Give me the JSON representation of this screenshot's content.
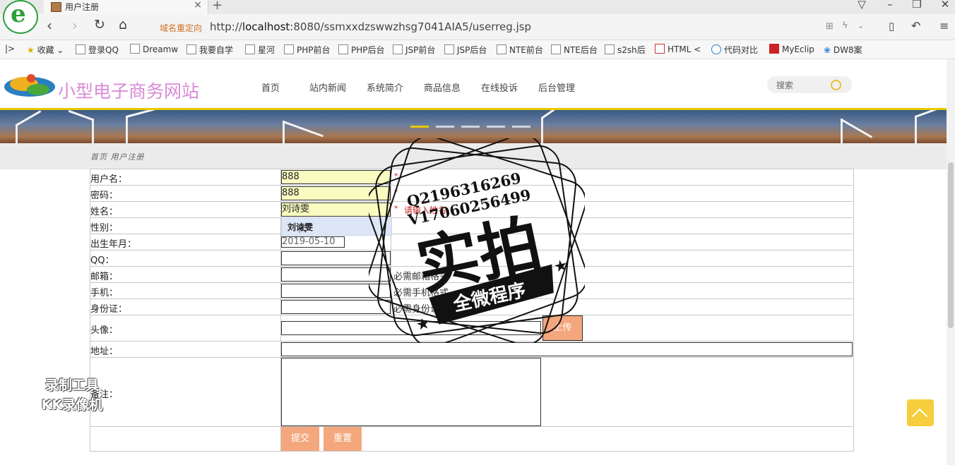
{
  "browser": {
    "tab_title": "用户注册",
    "tab_close": "×",
    "new_tab": "+",
    "redirect_label": "域名重定向",
    "url_prefix": "http://",
    "url_host": "localhost",
    "url_rest": ":8080/ssmxxdzswwzhsg7041AIA5/userreg.jsp",
    "bookmarks": [
      "收藏",
      "登录QQ",
      "Dreamw",
      "我要自学",
      "星河",
      "PHP前台",
      "PHP后台",
      "JSP前台",
      "JSP后台",
      "NTE前台",
      "NTE后台",
      "s2sh后",
      "HTML <",
      "代码对比",
      "MyEclip",
      "DW8案"
    ]
  },
  "site": {
    "title": "小型电子商务网站",
    "nav": [
      "首页",
      "站内新闻",
      "系统简介",
      "商品信息",
      "在线投诉",
      "后台管理"
    ],
    "search_placeholder": "搜索",
    "breadcrumb": "首页 用户注册"
  },
  "form": {
    "username_label": "用户名：",
    "username_value": "888",
    "password_label": "密码：",
    "password_value": "888",
    "name_label": "姓名：",
    "name_value": "刘诗雯",
    "name_hint": "请输入姓名",
    "autocomplete_option": "刘诗雯",
    "gender_label": "性别：",
    "birth_label": "出生年月：",
    "birth_value": "2019-05-10",
    "qq_label": "QQ：",
    "email_label": "邮箱：",
    "email_hint": "必需邮箱格式",
    "phone_label": "手机：",
    "phone_hint": "必需手机格式",
    "idcard_label": "身份证：",
    "idcard_hint": "必需身份证",
    "avatar_label": "头像：",
    "upload_label": "上传",
    "address_label": "地址：",
    "remark_label": "备注：",
    "submit_label": "提交",
    "reset_label": "重置",
    "required_mark": "*"
  },
  "watermark": {
    "stamp_line1": "Q2196316269",
    "stamp_line2": "V17060256499",
    "stamp_main": "实拍",
    "stamp_ribbon": "全微程序",
    "recorder_line1": "录制工具",
    "recorder_line2": "KK录像机"
  },
  "colors": {
    "site_title": "#d98bd6",
    "accent_yellow": "#e8c800",
    "button_orange": "#f4a77c",
    "input_autofill": "#f8fcc0"
  }
}
